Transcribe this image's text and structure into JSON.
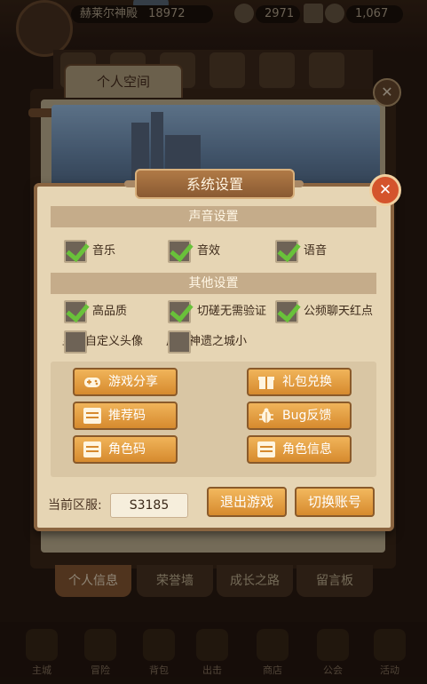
{
  "hud": {
    "player_name": "赫莱尔神殿",
    "power": "18972",
    "gold": "2971",
    "gems": "1,067"
  },
  "personal_space": {
    "tab_label": "个人空间"
  },
  "bottom_tabs": [
    "个人信息",
    "荣誉墙",
    "成长之路",
    "留言板"
  ],
  "bottom_nav": [
    "主城",
    "冒险",
    "背包",
    "出击",
    "商店",
    "公会",
    "活动"
  ],
  "dialog": {
    "title": "系统设置",
    "sound_section": "声音设置",
    "sound_options": [
      {
        "label": "音乐",
        "checked": true
      },
      {
        "label": "音效",
        "checked": true
      },
      {
        "label": "语音",
        "checked": true
      }
    ],
    "other_section": "其他设置",
    "other_options": [
      {
        "label": "高品质",
        "checked": true
      },
      {
        "label": "切磋无需验证",
        "checked": true
      },
      {
        "label": "公频聊天红点",
        "checked": true
      },
      {
        "label": "显示自定义头像",
        "checked": false
      },
      {
        "label": "启用神遗之城小",
        "checked": false
      }
    ],
    "buttons": {
      "share": "游戏分享",
      "gift": "礼包兑换",
      "referral": "推荐码",
      "bug": "Bug反馈",
      "role_code": "角色码",
      "role_info": "角色信息"
    },
    "server_label": "当前区服:",
    "server_value": "S3185",
    "exit_label": "退出游戏",
    "switch_label": "切换账号"
  },
  "colors": {
    "accent_orange": "#d68a2e",
    "check_green": "#69c13a",
    "close_red": "#d4542c"
  }
}
